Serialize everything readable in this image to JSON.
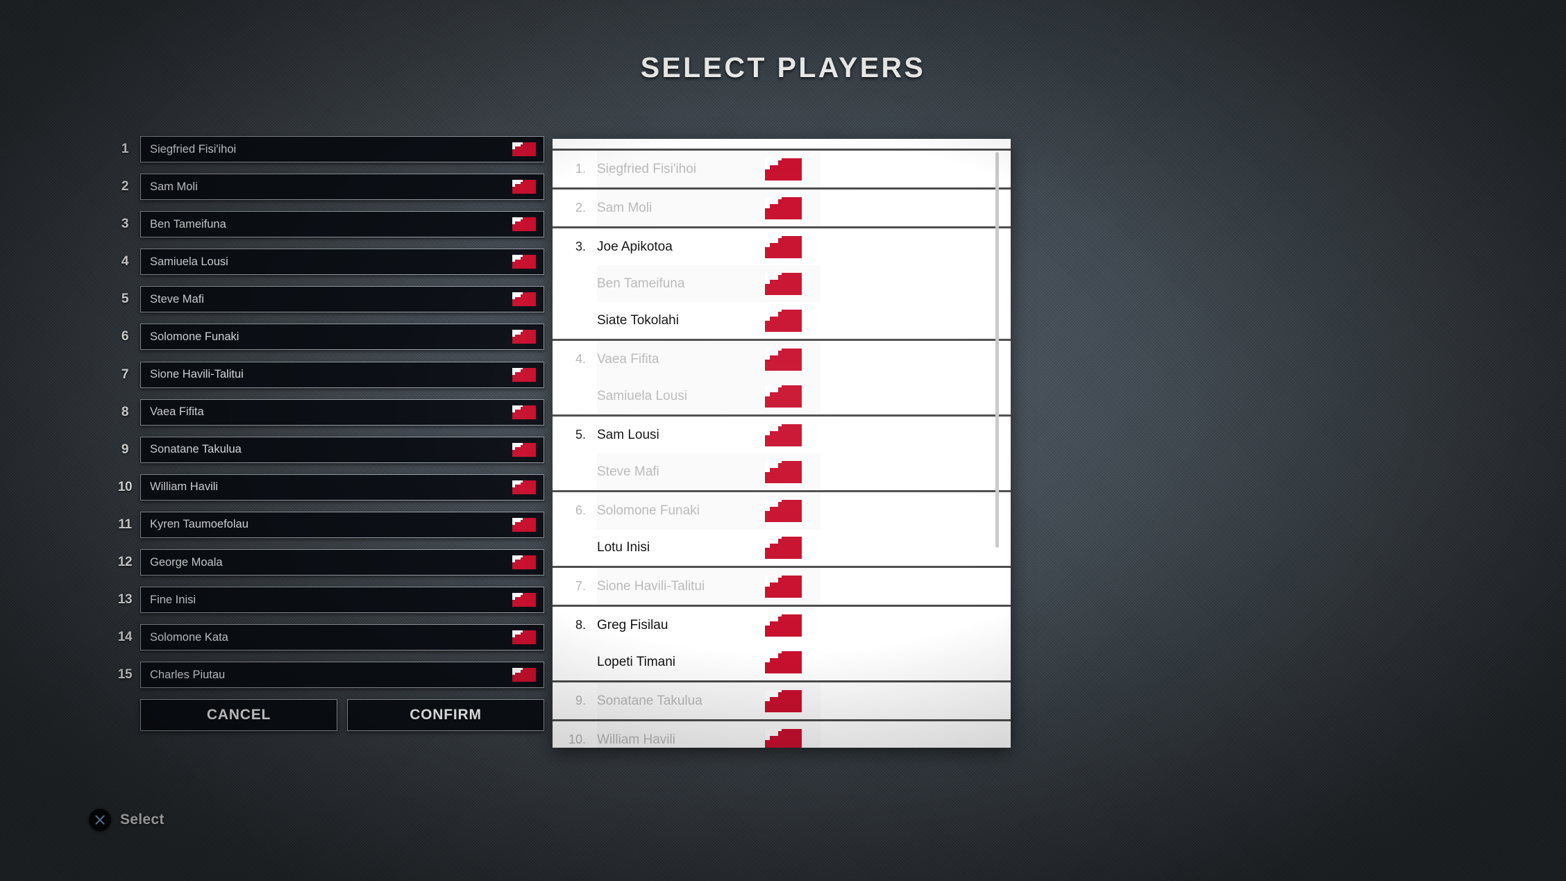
{
  "page": {
    "title": "SELECT PLAYERS",
    "background_color": "#434b52",
    "accent_color": "#c8102e",
    "panel_color": "#ffffff",
    "field_color": "#0c1016"
  },
  "lineup": {
    "rows": [
      {
        "number": "1",
        "name": "Siegfried Fisi'ihoi",
        "flag": "tonga-flag-icon"
      },
      {
        "number": "2",
        "name": "Sam Moli",
        "flag": "tonga-flag-icon"
      },
      {
        "number": "3",
        "name": "Ben Tameifuna",
        "flag": "tonga-flag-icon"
      },
      {
        "number": "4",
        "name": "Samiuela Lousi",
        "flag": "tonga-flag-icon"
      },
      {
        "number": "5",
        "name": "Steve Mafi",
        "flag": "tonga-flag-icon"
      },
      {
        "number": "6",
        "name": "Solomone Funaki",
        "flag": "tonga-flag-icon"
      },
      {
        "number": "7",
        "name": "Sione Havili-Talitui",
        "flag": "tonga-flag-icon"
      },
      {
        "number": "8",
        "name": "Vaea Fifita",
        "flag": "tonga-flag-icon"
      },
      {
        "number": "9",
        "name": "Sonatane Takulua",
        "flag": "tonga-flag-icon"
      },
      {
        "number": "10",
        "name": "William Havili",
        "flag": "tonga-flag-icon"
      },
      {
        "number": "11",
        "name": "Kyren Taumoefolau",
        "flag": "tonga-flag-icon"
      },
      {
        "number": "12",
        "name": "George Moala",
        "flag": "tonga-flag-icon"
      },
      {
        "number": "13",
        "name": "Fine Inisi",
        "flag": "tonga-flag-icon"
      },
      {
        "number": "14",
        "name": "Solomone Kata",
        "flag": "tonga-flag-icon"
      },
      {
        "number": "15",
        "name": "Charles Piutau",
        "flag": "tonga-flag-icon"
      }
    ],
    "buttons": {
      "cancel_label": "CANCEL",
      "confirm_label": "CONFIRM"
    }
  },
  "squad": {
    "groups": [
      {
        "rows": [
          {
            "index": "1.",
            "name": "Siegfried Fisi'ihoi",
            "flag": "tonga-flag-icon",
            "disabled": true
          }
        ]
      },
      {
        "rows": [
          {
            "index": "2.",
            "name": "Sam Moli",
            "flag": "tonga-flag-icon",
            "disabled": true
          }
        ]
      },
      {
        "rows": [
          {
            "index": "3.",
            "name": "Joe Apikotoa",
            "flag": "tonga-flag-icon",
            "disabled": false
          },
          {
            "index": "",
            "name": "Ben Tameifuna",
            "flag": "tonga-flag-icon",
            "disabled": true
          },
          {
            "index": "",
            "name": "Siate Tokolahi",
            "flag": "tonga-flag-icon",
            "disabled": false
          }
        ]
      },
      {
        "rows": [
          {
            "index": "4.",
            "name": "Vaea Fifita",
            "flag": "tonga-flag-icon",
            "disabled": true
          },
          {
            "index": "",
            "name": "Samiuela Lousi",
            "flag": "tonga-flag-icon",
            "disabled": true
          }
        ]
      },
      {
        "rows": [
          {
            "index": "5.",
            "name": "Sam Lousi",
            "flag": "tonga-flag-icon",
            "disabled": false
          },
          {
            "index": "",
            "name": "Steve Mafi",
            "flag": "tonga-flag-icon",
            "disabled": true
          }
        ]
      },
      {
        "rows": [
          {
            "index": "6.",
            "name": "Solomone Funaki",
            "flag": "tonga-flag-icon",
            "disabled": true
          },
          {
            "index": "",
            "name": "Lotu Inisi",
            "flag": "tonga-flag-icon",
            "disabled": false
          }
        ]
      },
      {
        "rows": [
          {
            "index": "7.",
            "name": "Sione Havili-Talitui",
            "flag": "tonga-flag-icon",
            "disabled": true
          }
        ]
      },
      {
        "rows": [
          {
            "index": "8.",
            "name": "Greg Fisilau",
            "flag": "tonga-flag-icon",
            "disabled": false
          },
          {
            "index": "",
            "name": "Lopeti Timani",
            "flag": "tonga-flag-icon",
            "disabled": false
          }
        ]
      },
      {
        "rows": [
          {
            "index": "9.",
            "name": "Sonatane Takulua",
            "flag": "tonga-flag-icon",
            "disabled": true
          }
        ]
      },
      {
        "rows": [
          {
            "index": "10.",
            "name": "William Havili",
            "flag": "tonga-flag-icon",
            "disabled": true
          }
        ]
      }
    ]
  },
  "bottom_prompt": {
    "icon": "cross-button-icon",
    "label": "Select"
  }
}
